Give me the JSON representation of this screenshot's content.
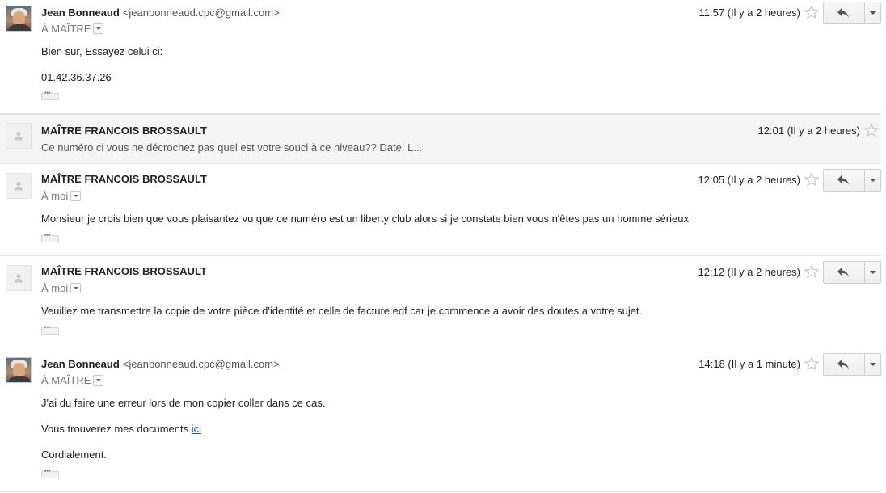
{
  "messages": [
    {
      "sender": "Jean Bonneaud",
      "email": "<jeanbonneaud.cpc@gmail.com>",
      "to": "À MAÎTRE",
      "time": "11:57 (Il y a 2 heures)",
      "lines": [
        "Bien sur, Essayez celui ci:",
        "01.42.36.37.26"
      ]
    },
    {
      "sender": "MAÎTRE FRANCOIS BROSSAULT",
      "time": "12:01 (Il y a 2 heures)",
      "snippet": "Ce numéro ci vous ne décrochez pas quel est votre souci à ce niveau?? Date: L..."
    },
    {
      "sender": "MAÎTRE FRANCOIS BROSSAULT",
      "to": "À moi",
      "time": "12:05 (Il y a 2 heures)",
      "lines": [
        "Monsieur je crois bien que vous plaisantez vu que ce numéro est un liberty club alors si je constate bien vous n'êtes pas un homme sérieux"
      ]
    },
    {
      "sender": "MAÎTRE FRANCOIS BROSSAULT",
      "to": "À moi",
      "time": "12:12 (Il y a 2 heures)",
      "lines": [
        "Veuillez me transmettre la copie de votre pièce d'identité et celle de facture edf car je commence a avoir des doutes a votre sujet."
      ]
    },
    {
      "sender": "Jean Bonneaud",
      "email": "<jeanbonneaud.cpc@gmail.com>",
      "to": "À MAÎTRE",
      "time": "14:18 (Il y a 1 minute)",
      "lines": [
        "J'ai du faire une erreur lors de mon copier coller dans ce cas.",
        "Vous trouverez mes documents ",
        "Cordialement."
      ],
      "link_text": "ici"
    }
  ],
  "icons": {
    "star": "star-icon",
    "reply": "reply-icon",
    "more": "chevron-down-icon",
    "blank_avatar": "person-icon"
  },
  "colors": {
    "link": "#1155cc",
    "collapsed_bg": "#f5f5f5"
  }
}
